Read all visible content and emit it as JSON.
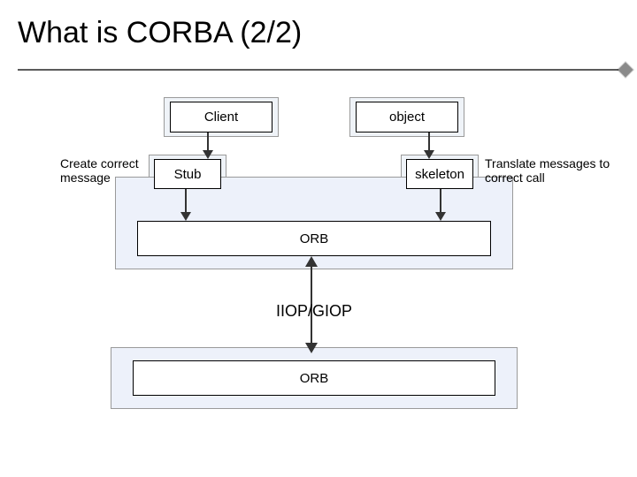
{
  "title": "What is CORBA (2/2)",
  "leftNote": "Create correct message",
  "rightNote": "Translate messages to correct call",
  "client": "Client",
  "object": "object",
  "stub": "Stub",
  "skeleton": "skeleton",
  "orb1": "ORB",
  "iiop": "IIOP/GIOP",
  "orb2": "ORB"
}
